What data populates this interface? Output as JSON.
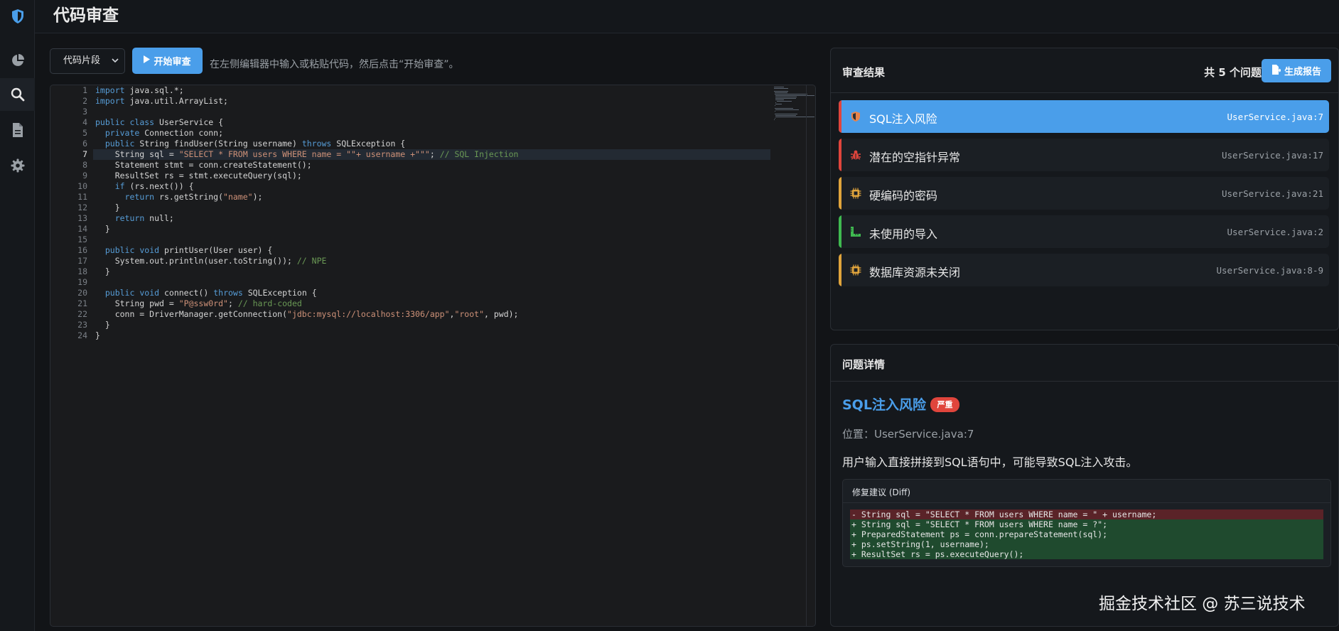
{
  "header": {
    "title": "代码审查"
  },
  "sidebar": {
    "items": [
      {
        "icon": "shield-logo-icon"
      },
      {
        "icon": "pie-chart-icon"
      },
      {
        "icon": "search-icon"
      },
      {
        "icon": "document-icon"
      },
      {
        "icon": "gear-icon"
      }
    ]
  },
  "toolbar": {
    "select_value": "代码片段",
    "start_label": "开始审查",
    "hint": "在左侧编辑器中输入或粘贴代码，然后点击“开始审查”。"
  },
  "editor": {
    "current_line": 7,
    "line_numbers": [
      "1",
      "2",
      "3",
      "4",
      "5",
      "6",
      "7",
      "8",
      "9",
      "10",
      "11",
      "12",
      "13",
      "14",
      "15",
      "16",
      "17",
      "18",
      "19",
      "20",
      "21",
      "22",
      "23",
      "24"
    ],
    "lines": [
      "import java.sql.*;",
      "import java.util.ArrayList;",
      "",
      "public class UserService {",
      "  private Connection conn;",
      "  public String findUser(String username) throws SQLException {",
      "    String sql = \"SELECT * FROM users WHERE name = \"\"+ username +\"\"\"; // SQL Injection",
      "    Statement stmt = conn.createStatement();",
      "    ResultSet rs = stmt.executeQuery(sql);",
      "    if (rs.next()) {",
      "      return rs.getString(\"name\");",
      "    }",
      "    return null;",
      "  }",
      "",
      "  public void printUser(User user) {",
      "    System.out.println(user.toString()); // NPE",
      "  }",
      "",
      "  public void connect() throws SQLException {",
      "    String pwd = \"P@ssw0rd\"; // hard-coded",
      "    conn = DriverManager.getConnection(\"jdbc:mysql://localhost:3306/app\",\"root\", pwd);",
      "  }",
      "}"
    ]
  },
  "results": {
    "title": "审查结果",
    "count_text": "共 5 个问题",
    "report_label": "生成报告",
    "issues": [
      {
        "title": "SQL注入风险",
        "location": "UserService.java:7",
        "color": "#e0453c",
        "icon": "shield-warning-icon"
      },
      {
        "title": "潜在的空指针异常",
        "location": "UserService.java:17",
        "color": "#e0453c",
        "icon": "bug-icon"
      },
      {
        "title": "硬编码的密码",
        "location": "UserService.java:21",
        "color": "#e0a43c",
        "icon": "chip-icon"
      },
      {
        "title": "未使用的导入",
        "location": "UserService.java:2",
        "color": "#3fb950",
        "icon": "ruler-icon"
      },
      {
        "title": "数据库资源未关闭",
        "location": "UserService.java:8-9",
        "color": "#e0a43c",
        "icon": "chip-icon"
      }
    ]
  },
  "detail": {
    "title": "问题详情",
    "issue_title": "SQL注入风险",
    "severity": "严重",
    "location": "位置：UserService.java:7",
    "description": "用户输入直接拼接到SQL语句中，可能导致SQL注入攻击。",
    "diff_title": "修复建议 (Diff)",
    "diff_lines": [
      {
        "type": "del",
        "text": "- String sql = \"SELECT * FROM users WHERE name = \" + username;"
      },
      {
        "type": "add",
        "text": "+ String sql = \"SELECT * FROM users WHERE name = ?\";"
      },
      {
        "type": "add",
        "text": "+ PreparedStatement ps = conn.prepareStatement(sql);"
      },
      {
        "type": "add",
        "text": "+ ps.setString(1, username);"
      },
      {
        "type": "add",
        "text": "+ ResultSet rs = ps.executeQuery();"
      }
    ]
  },
  "watermark": "掘金技术社区 @ 苏三说技术",
  "colors": {
    "accent": "#4a9eea",
    "danger": "#e0453c",
    "warning": "#e0a43c",
    "success": "#3fb950"
  }
}
